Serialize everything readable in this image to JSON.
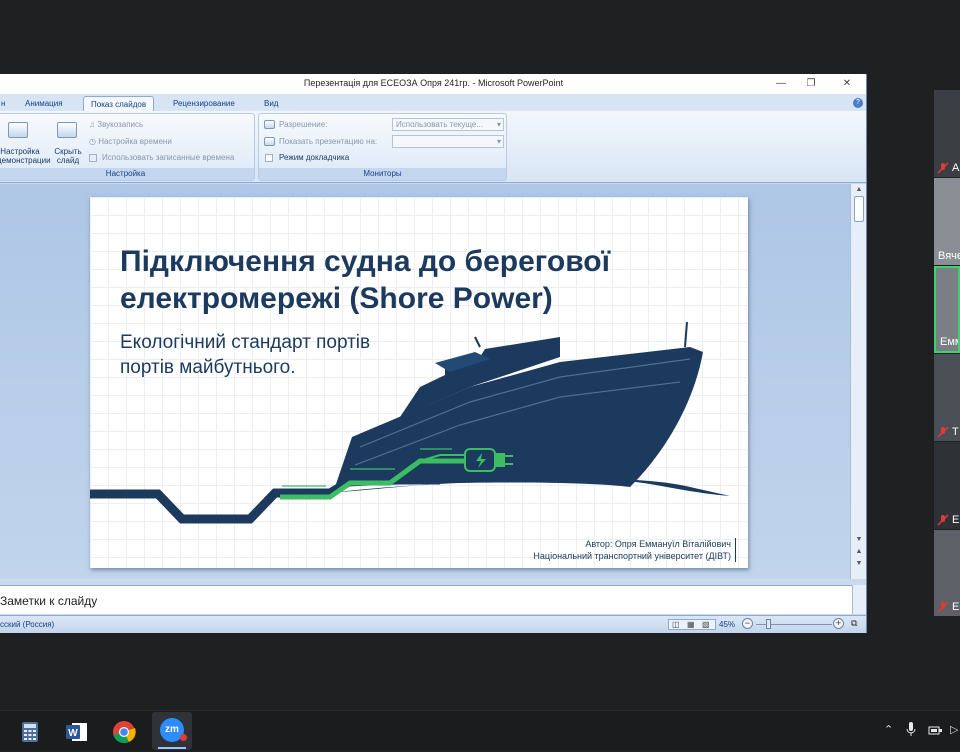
{
  "window": {
    "title": "Перезентація для ЕСЕОЗА Опря 241гр. - Microsoft PowerPoint"
  },
  "ribbon": {
    "tabs": [
      {
        "label": "н"
      },
      {
        "label": "Анимация"
      },
      {
        "label": "Показ слайдов"
      },
      {
        "label": "Рецензирование"
      },
      {
        "label": "Вид"
      }
    ],
    "setup_group": {
      "label": "Настройка",
      "setup_button": "Настройка\nдемонстрации",
      "hide_button": "Скрыть\nслайд",
      "record": "Звукозапись",
      "rehearse": "Настройка времени",
      "use_timings": "Использовать записанные времена"
    },
    "monitors_group": {
      "label": "Мониторы",
      "resolution_label": "Разрешение:",
      "resolution_value": "Использовать текуще...",
      "show_on_label": "Показать презентацию на:",
      "presenter_view": "Режим докладчика"
    }
  },
  "slide": {
    "title_line1": "Підключення судна до берегової",
    "title_line2": "електромережі (Shore Power)",
    "subtitle_line1": "Екологічний стандарт портів",
    "subtitle_line2": "портів майбутнього.",
    "author_line1": "Автор: Опря Еммануїл Віталійович",
    "author_line2": "Національний транспортний університет (ДІВТ)"
  },
  "notes": {
    "placeholder": "Заметки к слайду"
  },
  "statusbar": {
    "language": "сский (Россия)",
    "zoom": "45%"
  },
  "participants": [
    {
      "name": "А"
    },
    {
      "name": "Вяче"
    },
    {
      "name": "Емм"
    },
    {
      "name": "Т"
    },
    {
      "name": "Е"
    },
    {
      "name": "Е"
    }
  ],
  "taskbar": {
    "zoom_label": "zm"
  },
  "colors": {
    "navy": "#1c3a5e",
    "green": "#3dbd63",
    "ribbon_blue": "#15428b",
    "zoom_blue": "#2d8cff"
  }
}
